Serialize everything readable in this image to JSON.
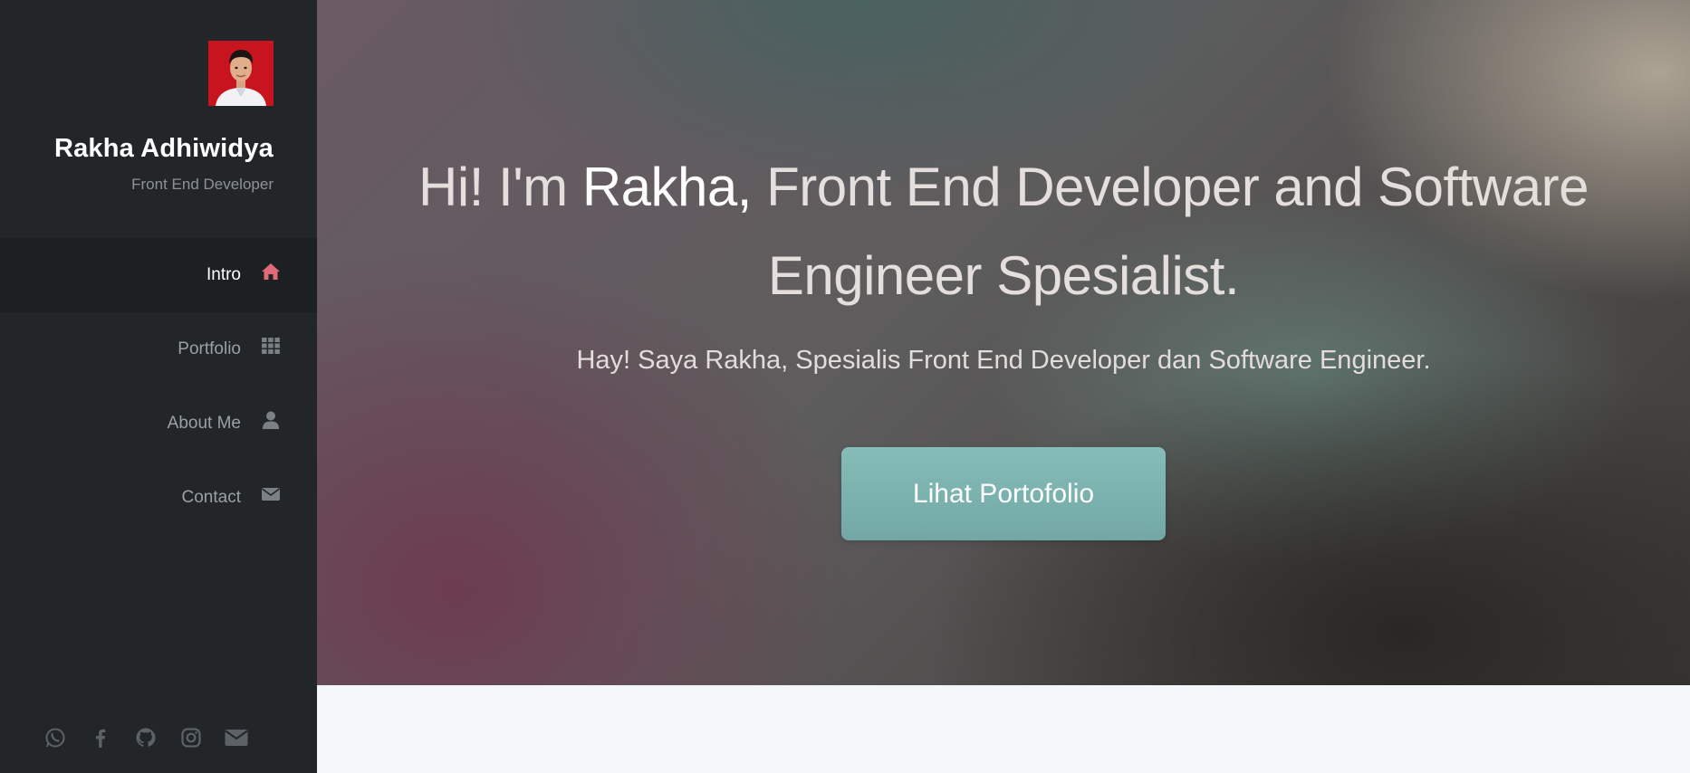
{
  "profile": {
    "name": "Rakha Adhiwidya",
    "role": "Front End Developer"
  },
  "nav": {
    "items": [
      {
        "label": "Intro",
        "icon": "home-icon",
        "active": true
      },
      {
        "label": "Portfolio",
        "icon": "grid-icon",
        "active": false
      },
      {
        "label": "About Me",
        "icon": "user-icon",
        "active": false
      },
      {
        "label": "Contact",
        "icon": "envelope-icon",
        "active": false
      }
    ]
  },
  "socials": [
    "whatsapp-icon",
    "facebook-icon",
    "github-icon",
    "instagram-icon",
    "email-icon"
  ],
  "hero": {
    "title_prefix": "Hi! I'm ",
    "title_name": "Rakha,",
    "title_rest": " Front End Developer and Software Engineer Spesialist.",
    "subtitle": "Hay! Saya Rakha, Spesialis Front End Developer dan Software Engineer.",
    "button_label": "Lihat Portofolio"
  },
  "colors": {
    "sidebar_bg": "#222629",
    "active_icon": "#e06a78",
    "button_bg": "#7db4b1"
  }
}
